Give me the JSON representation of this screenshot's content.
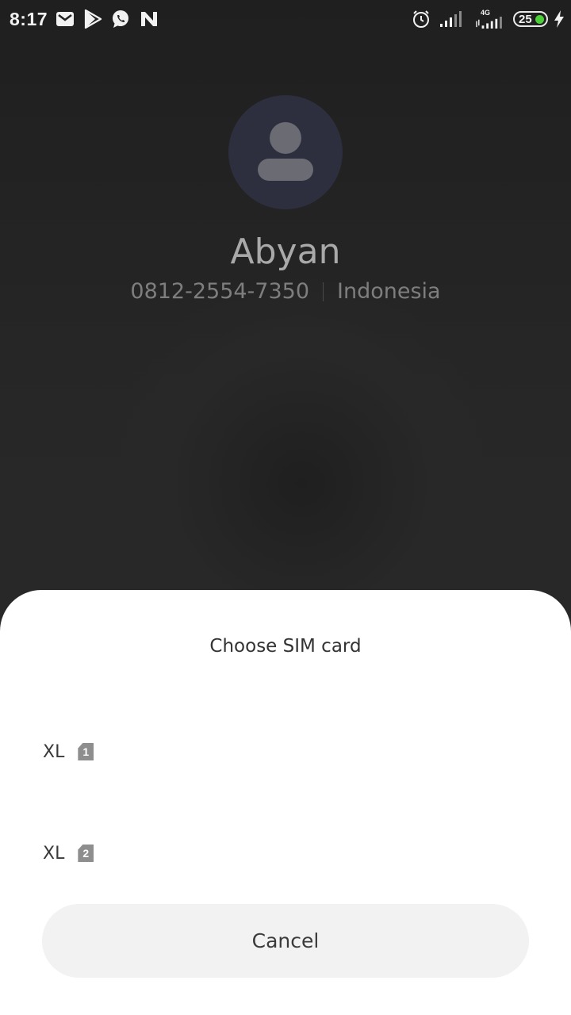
{
  "status_bar": {
    "time": "8:17",
    "battery": "25",
    "network": "4G",
    "icons": [
      "gmail-icon",
      "play-store-icon",
      "whatsapp-icon",
      "n-app-icon",
      "alarm-icon",
      "signal-icon",
      "signal-4g-icon",
      "battery-icon",
      "charging-icon"
    ]
  },
  "caller": {
    "name": "Abyan",
    "number": "0812-2554-7350",
    "location": "Indonesia"
  },
  "sim_dialog": {
    "title": "Choose SIM card",
    "options": [
      {
        "label": "XL",
        "slot": "1"
      },
      {
        "label": "XL",
        "slot": "2"
      }
    ],
    "cancel_label": "Cancel"
  },
  "colors": {
    "background": "#272727",
    "sheet": "#ffffff",
    "cancel_bg": "#f2f2f2",
    "battery_dot": "#4cd039"
  }
}
